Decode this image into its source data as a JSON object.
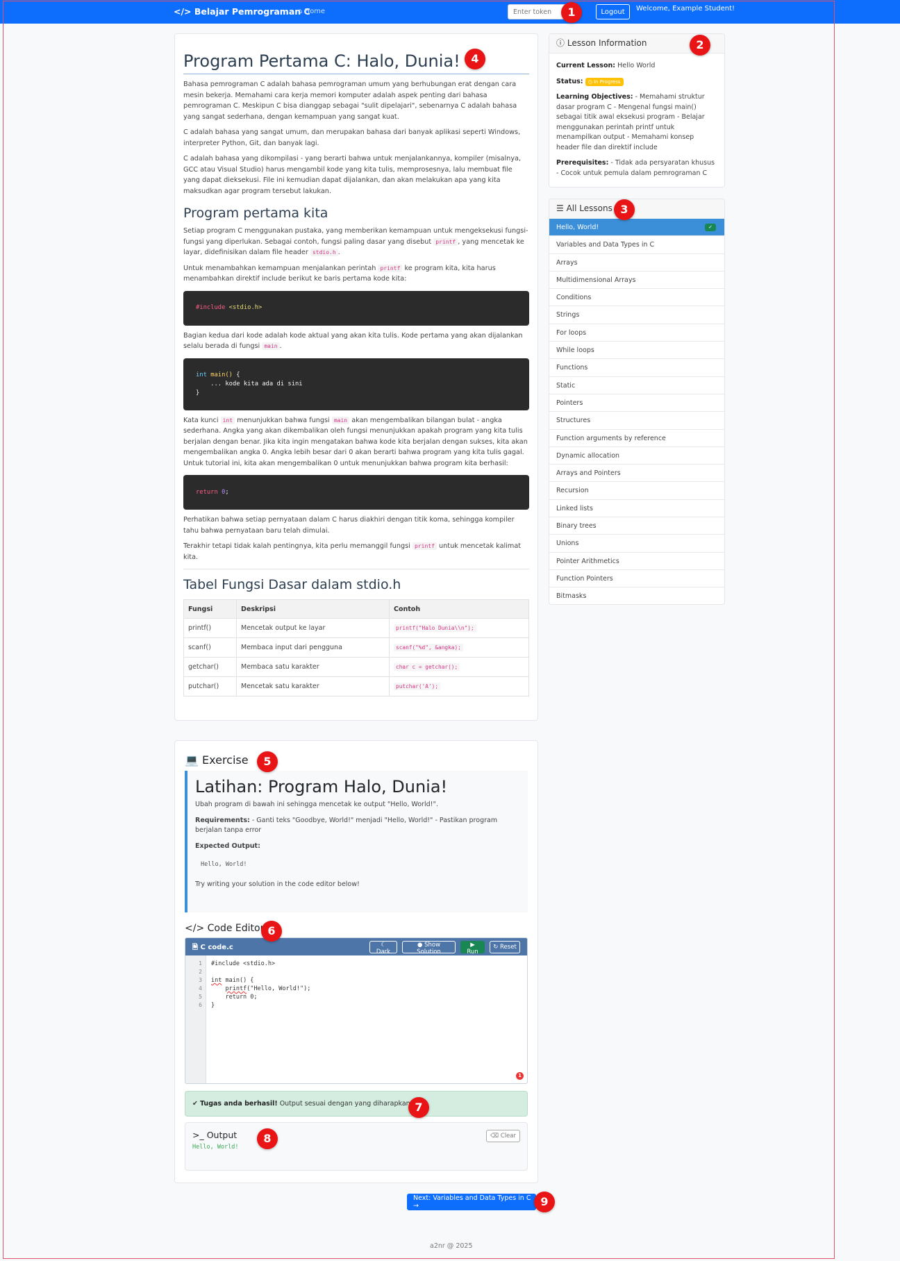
{
  "navbar": {
    "brand_icon": "</>",
    "brand": "Belajar Pemrograman C",
    "home": "Home",
    "token_placeholder": "Enter token",
    "logout": "Logout",
    "welcome": "Welcome, Example Student!",
    "color": "#0d6efd"
  },
  "annotations": [
    "1",
    "2",
    "3",
    "4",
    "5",
    "6",
    "7",
    "8",
    "9"
  ],
  "lesson": {
    "title": "Program Pertama C: Halo, Dunia!",
    "p1": "Bahasa pemrograman C adalah bahasa pemrograman umum yang berhubungan erat dengan cara mesin bekerja. Memahami cara kerja memori komputer adalah aspek penting dari bahasa pemrograman C. Meskipun C bisa dianggap sebagai \"sulit dipelajari\", sebenarnya C adalah bahasa yang sangat sederhana, dengan kemampuan yang sangat kuat.",
    "p2": "C adalah bahasa yang sangat umum, dan merupakan bahasa dari banyak aplikasi seperti Windows, interpreter Python, Git, dan banyak lagi.",
    "p3": "C adalah bahasa yang dikompilasi - yang berarti bahwa untuk menjalankannya, kompiler (misalnya, GCC atau Visual Studio) harus mengambil kode yang kita tulis, memprosesnya, lalu membuat file yang dapat dieksekusi. File ini kemudian dapat dijalankan, dan akan melakukan apa yang kita maksudkan agar program tersebut lakukan.",
    "h2_first": "Program pertama kita",
    "p4_a": "Setiap program C menggunakan pustaka, yang memberikan kemampuan untuk mengeksekusi fungsi-fungsi yang diperlukan. Sebagai contoh, fungsi paling dasar yang disebut ",
    "p4_code1": "printf",
    "p4_b": ", yang mencetak ke layar, didefinisikan dalam file header ",
    "p4_code2": "stdio.h",
    "p4_c": ".",
    "p5_a": "Untuk menambahkan kemampuan menjalankan perintah ",
    "p5_code": "printf",
    "p5_b": " ke program kita, kita harus menambahkan direktif include berikut ke baris pertama kode kita:",
    "code1_hash": "#",
    "code1_kw": "include",
    "code1_rest": " <stdio.h>",
    "p6_a": "Bagian kedua dari kode adalah kode aktual yang akan kita tulis. Kode pertama yang akan dijalankan selalu berada di fungsi ",
    "p6_code": "main",
    "p6_b": ".",
    "code2_type": "int",
    "code2_fn": "main()",
    "code2_brace": " {",
    "code2_line2": "    ... kode kita ada di sini",
    "code2_line3": "}",
    "p7_a": "Kata kunci ",
    "p7_code1": "int",
    "p7_b": " menunjukkan bahwa fungsi ",
    "p7_code2": "main",
    "p7_c": " akan mengembalikan bilangan bulat - angka sederhana. Angka yang akan dikembalikan oleh fungsi menunjukkan apakah program yang kita tulis berjalan dengan benar. Jika kita ingin mengatakan bahwa kode kita berjalan dengan sukses, kita akan mengembalikan angka 0. Angka lebih besar dari 0 akan berarti bahwa program yang kita tulis gagal. Untuk tutorial ini, kita akan mengembalikan 0 untuk menunjukkan bahwa program kita berhasil:",
    "code3_kw": "return",
    "code3_num": "0",
    "code3_end": ";",
    "p8": "Perhatikan bahwa setiap pernyataan dalam C harus diakhiri dengan titik koma, sehingga kompiler tahu bahwa pernyataan baru telah dimulai.",
    "p9_a": "Terakhir tetapi tidak kalah pentingnya, kita perlu memanggil fungsi ",
    "p9_code": "printf",
    "p9_b": " untuk mencetak kalimat kita.",
    "table_title": "Tabel Fungsi Dasar dalam stdio.h",
    "table_headers": [
      "Fungsi",
      "Deskripsi",
      "Contoh"
    ],
    "table_rows": [
      [
        "printf()",
        "Mencetak output ke layar",
        "printf(\"Halo Dunia\\\\n\");"
      ],
      [
        "scanf()",
        "Membaca input dari pengguna",
        "scanf(\"%d\", &angka);"
      ],
      [
        "getchar()",
        "Membaca satu karakter",
        "char c = getchar();"
      ],
      [
        "putchar()",
        "Mencetak satu karakter",
        "putchar('A');"
      ]
    ]
  },
  "info": {
    "title": "Lesson Information",
    "current_label": "Current Lesson:",
    "current": "Hello World",
    "status_label": "Status:",
    "status": "In Progress",
    "status_color": "#ffc107",
    "objectives_label": "Learning Objectives:",
    "objectives": "- Memahami struktur dasar program C - Mengenal fungsi main() sebagai titik awal eksekusi program - Belajar menggunakan perintah printf untuk menampilkan output - Memahami konsep header file dan direktif include",
    "prereq_label": "Prerequisites:",
    "prereq": "- Tidak ada persyaratan khusus - Cocok untuk pemula dalam pemrograman C"
  },
  "lessons": {
    "title": "All Lessons",
    "items": [
      "Hello, World!",
      "Variables and Data Types in C",
      "Arrays",
      "Multidimensional Arrays",
      "Conditions",
      "Strings",
      "For loops",
      "While loops",
      "Functions",
      "Static",
      "Pointers",
      "Structures",
      "Function arguments by reference",
      "Dynamic allocation",
      "Arrays and Pointers",
      "Recursion",
      "Linked lists",
      "Binary trees",
      "Unions",
      "Pointer Arithmetics",
      "Function Pointers",
      "Bitmasks"
    ],
    "active_color": "#3b8fd8"
  },
  "exercise": {
    "heading": "Exercise",
    "title": "Latihan: Program Halo, Dunia!",
    "desc": "Ubah program di bawah ini sehingga mencetak ke output \"Hello, World!\".",
    "req_label": "Requirements:",
    "req": "- Ganti teks \"Goodbye, World!\" menjadi \"Hello, World!\" - Pastikan program berjalan tanpa error",
    "expected_label": "Expected Output:",
    "expected": "Hello, World!",
    "hint": "Try writing your solution in the code editor below!"
  },
  "editor": {
    "heading": "Code Editor",
    "filename": "C code.c",
    "btn_dark": "Dark",
    "btn_solution": "Show Solution",
    "btn_run": "Run",
    "btn_reset": "Reset",
    "line_numbers": "1\n2\n3\n4\n5\n6",
    "l1": "#include <stdio.h>",
    "l3_int": "int",
    "l3_rest": " main() {",
    "l4_indent": "    ",
    "l4_fn": "printf",
    "l4_rest": "(\"Hello, World!\");",
    "l5": "    return 0;",
    "l6": "}",
    "error_count": "1",
    "toolbar_color": "#4d75a8"
  },
  "alert": {
    "bold": "Tugas anda berhasil!",
    "text": " Output sesuai dengan yang diharapkan."
  },
  "output": {
    "title": "Output",
    "clear": "Clear",
    "text": "Hello, World!"
  },
  "next_button": "Next: Variables and Data Types in C →",
  "footer": "a2nr @ 2025"
}
